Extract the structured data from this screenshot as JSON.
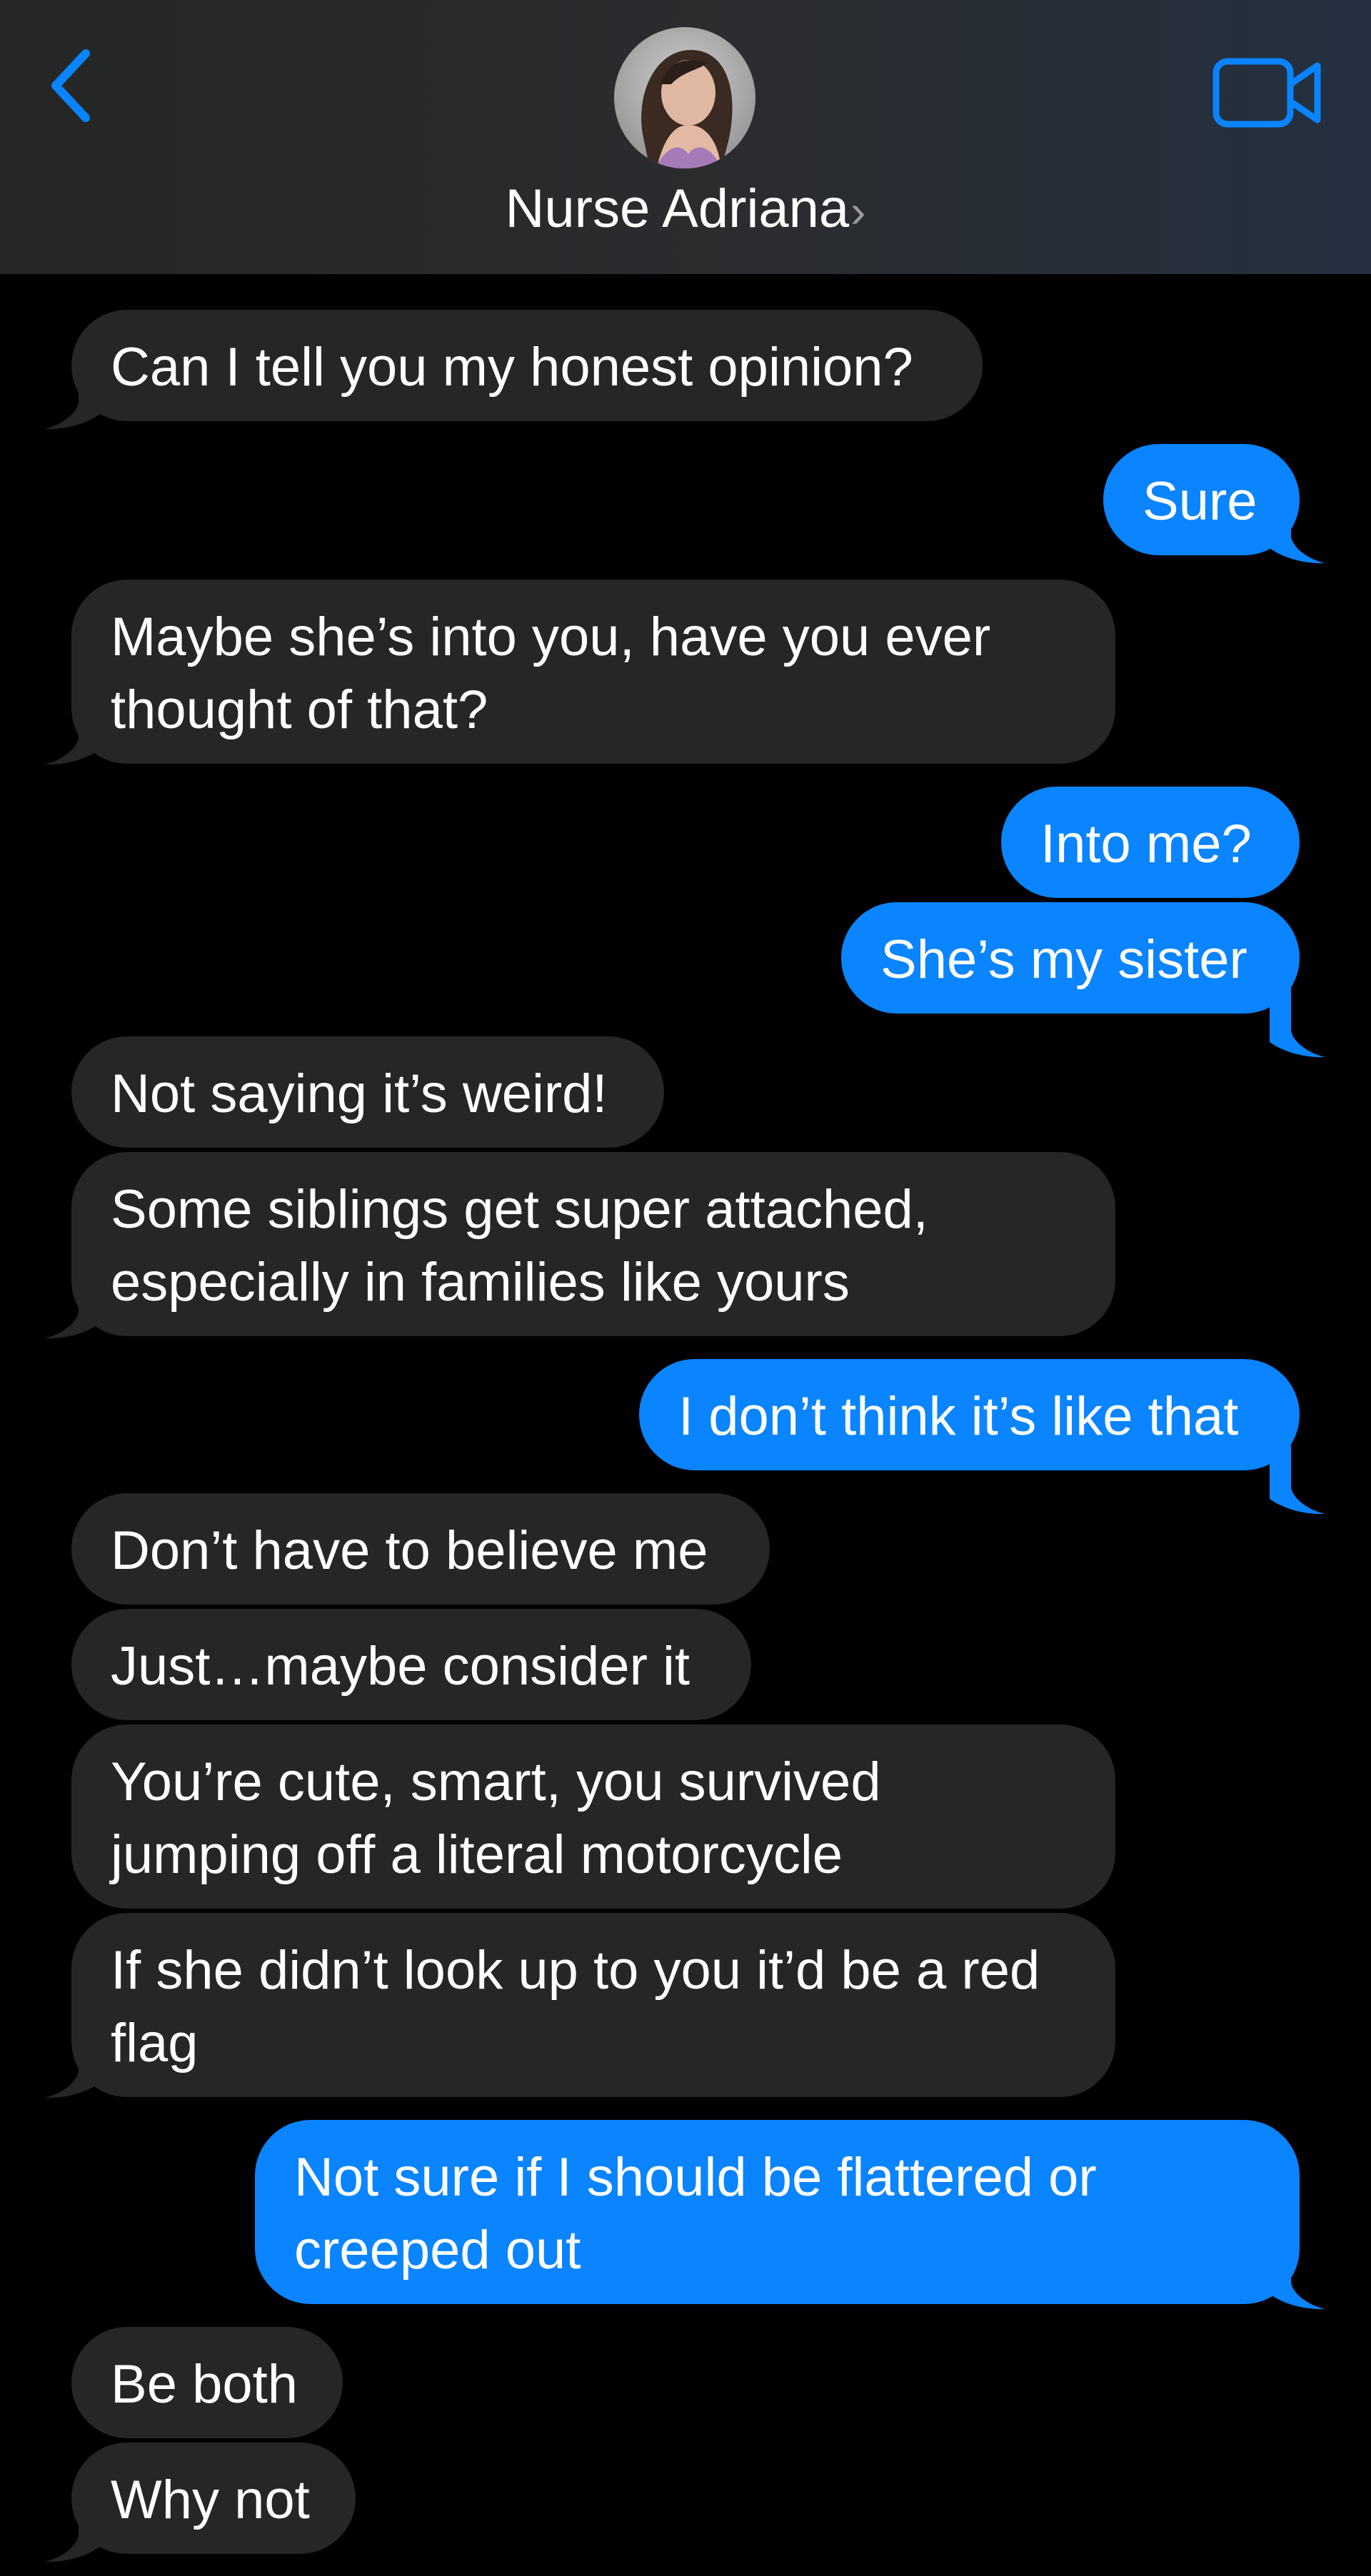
{
  "header": {
    "contact_name": "Nurse Adriana",
    "chevron": "›",
    "back_icon": "chevron-left-icon",
    "video_icon": "video-camera-icon",
    "accent_color": "#0a84ff"
  },
  "colors": {
    "background": "#000000",
    "sent_bubble": "#0a84ff",
    "received_bubble": "#262628",
    "text": "#ffffff"
  },
  "messages": [
    {
      "from": "them",
      "text": "Can I tell you my honest opinion?"
    },
    {
      "from": "me",
      "text": "Sure"
    },
    {
      "from": "them",
      "text": "Maybe she’s into you, have you ever thought of that?"
    },
    {
      "from": "me",
      "text": "Into me?"
    },
    {
      "from": "me",
      "text": "She’s my sister"
    },
    {
      "from": "them",
      "text": "Not saying it’s weird!"
    },
    {
      "from": "them",
      "text": "Some siblings get super attached, especially in families like yours"
    },
    {
      "from": "me",
      "text": "I don’t think it’s like that"
    },
    {
      "from": "them",
      "text": "Don’t have to believe me"
    },
    {
      "from": "them",
      "text": "Just…maybe consider it"
    },
    {
      "from": "them",
      "text": "You’re cute, smart, you survived jumping off a literal motorcycle"
    },
    {
      "from": "them",
      "text": "If she didn’t look up to you it’d be a red flag"
    },
    {
      "from": "me",
      "text": "Not sure if I should be flattered or creeped out"
    },
    {
      "from": "them",
      "text": "Be both"
    },
    {
      "from": "them",
      "text": "Why not"
    }
  ]
}
